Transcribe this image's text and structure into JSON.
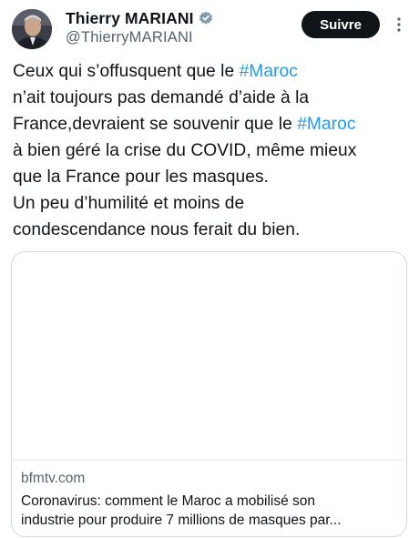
{
  "author": {
    "display_name": "Thierry MARIANI",
    "handle": "@ThierryMARIANI",
    "avatar_icon": "profile-photo",
    "verified_icon": "verified-badge-icon"
  },
  "actions": {
    "follow_label": "Suivre",
    "more_icon": "more-vertical-icon"
  },
  "tweet": {
    "lines": [
      [
        {
          "text": "Ceux qui s’offusquent que le "
        },
        {
          "text": "#Maroc",
          "hashtag": true
        }
      ],
      [
        {
          "text": "n’ait toujours pas demandé d’aide à la"
        }
      ],
      [
        {
          "text": "France,devraient se souvenir que le "
        },
        {
          "text": "#Maroc",
          "hashtag": true
        }
      ],
      [
        {
          "text": "à bien géré la crise du COVID, même mieux"
        }
      ],
      [
        {
          "text": "que la France pour les masques."
        }
      ],
      [
        {
          "text": "Un peu d’humilité et moins de"
        }
      ],
      [
        {
          "text": "condescendance nous ferait du bien."
        }
      ]
    ]
  },
  "link_card": {
    "domain": "bfmtv.com",
    "title_lines": [
      "Coronavirus: comment le Maroc a mobilisé son",
      "industrie pour produire 7 millions de masques par..."
    ]
  },
  "colors": {
    "hashtag": "#1d9bf0",
    "text": "#0f1419",
    "secondary": "#536471",
    "button_bg": "#0f1419",
    "border": "#cfd9de"
  }
}
